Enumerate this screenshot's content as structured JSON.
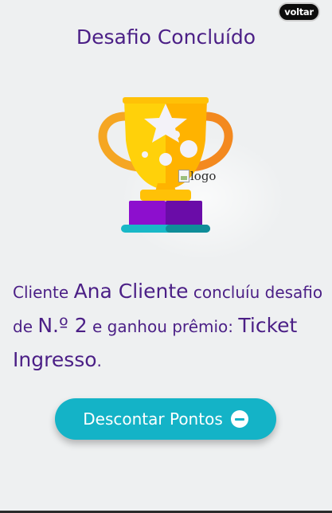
{
  "header": {
    "back_label": "voltar",
    "title": "Desafio Concluído"
  },
  "image": {
    "alt": "logo",
    "icon": "trophy-icon"
  },
  "message": {
    "prefix": "Cliente ",
    "client_name": "Ana Cliente",
    "middle1": " concluíu desafio de ",
    "challenge_number": "N.º 2",
    "middle2": " e ganhou prêmio: ",
    "prize": "Ticket Ingresso",
    "suffix": "."
  },
  "action": {
    "label": "Descontar Pontos",
    "icon": "minus-circle-icon",
    "color": "#14b3c7"
  },
  "colors": {
    "title": "#4b1f86",
    "background": "#eef0f1"
  }
}
